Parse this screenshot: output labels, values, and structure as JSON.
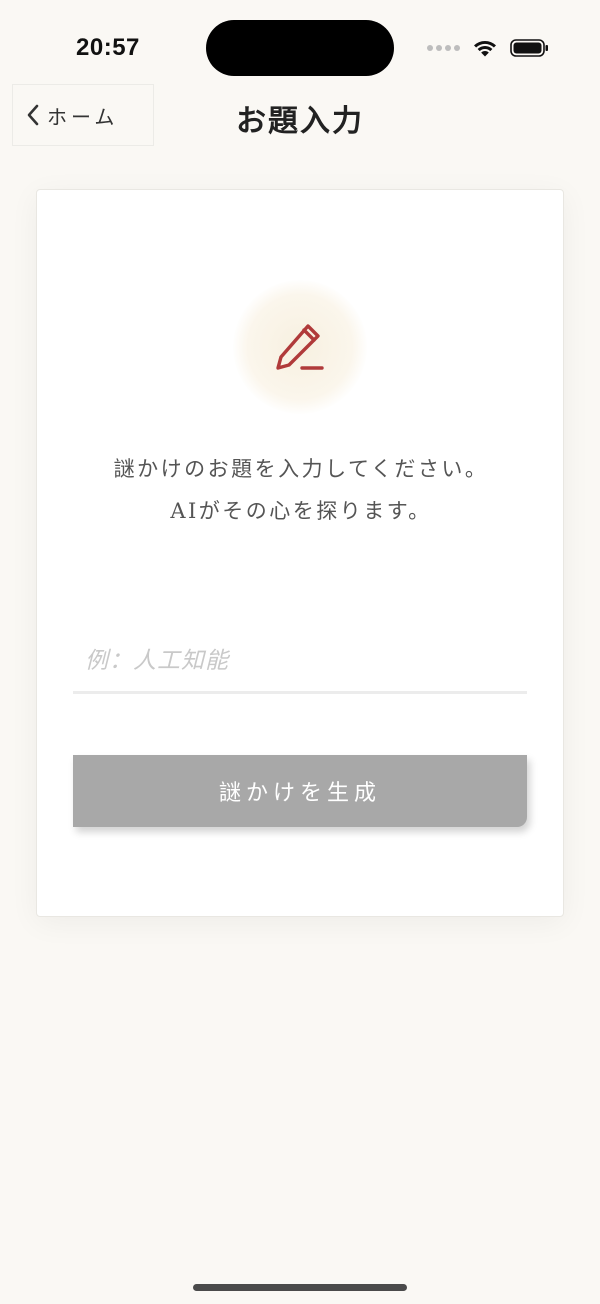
{
  "status_bar": {
    "time": "20:57"
  },
  "nav": {
    "back_label": "ホーム",
    "title": "お題入力"
  },
  "card": {
    "icon": "pencil-icon",
    "prompt_line1": "謎かけのお題を入力してください。",
    "prompt_line2": "AIがその心を探ります。",
    "input_value": "",
    "input_placeholder": "例：人工知能",
    "generate_label": "謎かけを生成"
  },
  "colors": {
    "background": "#faf8f4",
    "accent": "#b03a3a",
    "button_disabled": "#a8a8a8"
  }
}
